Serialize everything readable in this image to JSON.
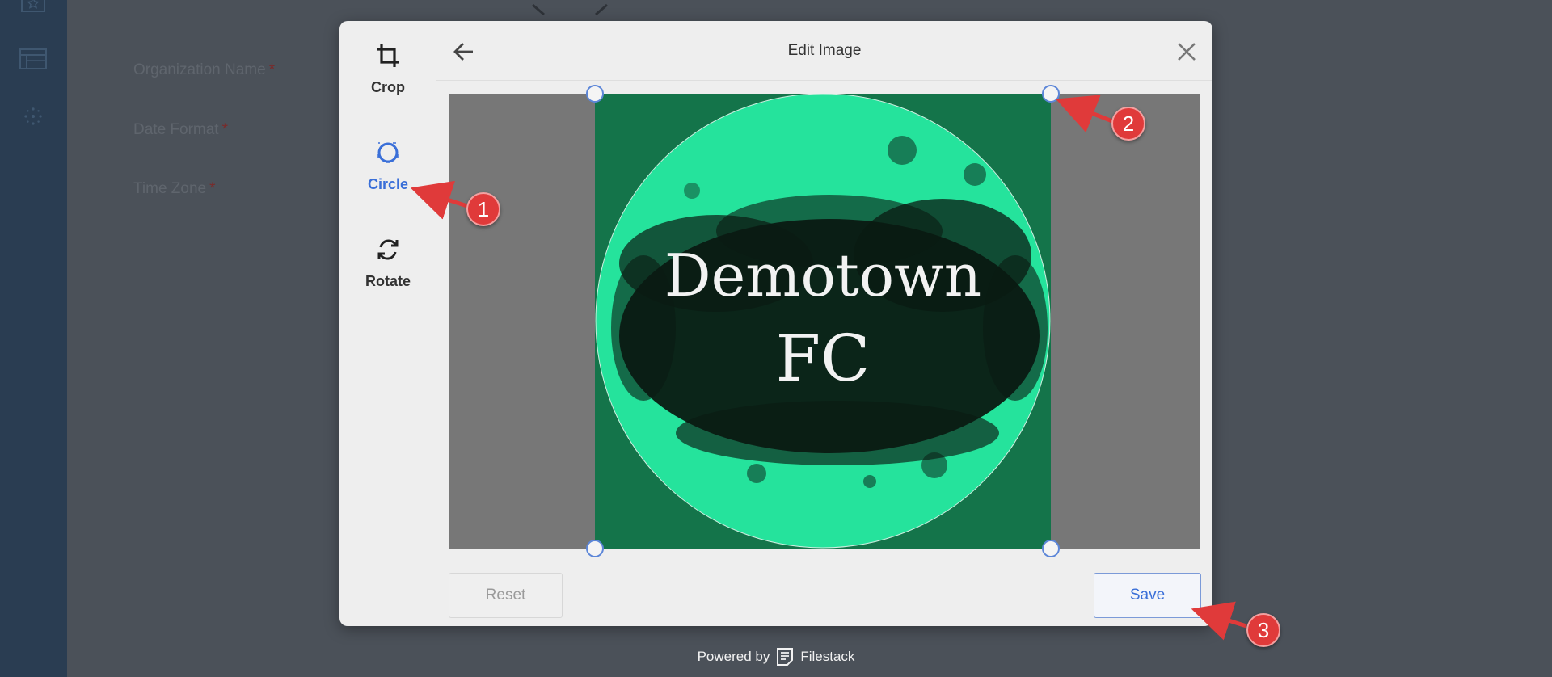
{
  "background": {
    "form_labels": [
      {
        "label": "Organization Name",
        "required": "*"
      },
      {
        "label": "Date Format",
        "required": "*"
      },
      {
        "label": "Time Zone",
        "required": "*"
      }
    ],
    "nav_icons": [
      "star-card-icon",
      "table-icon",
      "sparkle-icon"
    ]
  },
  "editor": {
    "title": "Edit Image",
    "tools": [
      {
        "label": "Crop",
        "icon": "crop-icon",
        "active": false
      },
      {
        "label": "Circle",
        "icon": "circle-crop-icon",
        "active": true
      },
      {
        "label": "Rotate",
        "icon": "rotate-icon",
        "active": false
      }
    ],
    "image_text": {
      "line1": "Demotown",
      "line2": "FC"
    },
    "reset_label": "Reset",
    "save_label": "Save"
  },
  "footer": {
    "powered_by": "Powered by",
    "brand": "Filestack"
  },
  "annotations": [
    "1",
    "2",
    "3"
  ],
  "colors": {
    "accent": "#3a6fd8",
    "logo_circle": "#25e39c",
    "logo_bg": "#14744a",
    "badge": "#e03a3a"
  }
}
